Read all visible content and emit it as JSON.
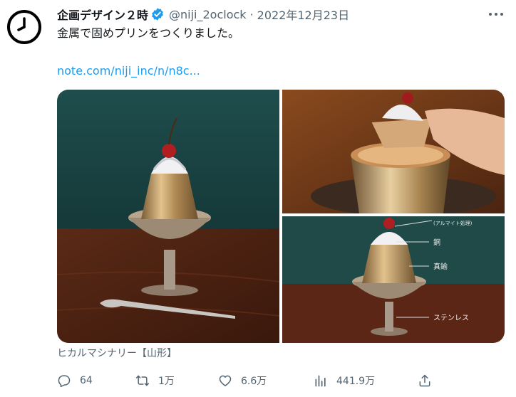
{
  "tweet": {
    "display_name": "企画デザイン２時",
    "handle": "@niji_2oclock",
    "separator": "·",
    "date": "2022年12月23日",
    "text": "金属で固めプリンをつくりました。",
    "link": "note.com/niji_inc/n/n8c...",
    "media_caption": "ヒカルマシナリー【山形】"
  },
  "media": {
    "labels": {
      "alumite": "(アルマイト処理)",
      "copper": "銅",
      "brass": "真鍮",
      "stainless": "ステンレス"
    }
  },
  "actions": {
    "replies": "64",
    "retweets": "1万",
    "likes": "6.6万",
    "views": "441.9万"
  },
  "icons": [
    "clock-avatar-icon",
    "verified-badge-icon",
    "more-icon",
    "reply-icon",
    "retweet-icon",
    "like-icon",
    "views-icon",
    "share-icon"
  ],
  "colors": {
    "link": "#1d9bf0",
    "verified": "#1d9bf0",
    "secondary": "#536471"
  }
}
